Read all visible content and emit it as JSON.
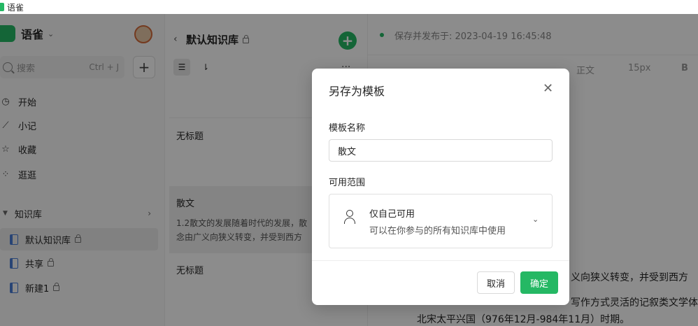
{
  "window": {
    "title": "语雀"
  },
  "sidebar": {
    "brand": "语雀",
    "search": {
      "placeholder": "搜索",
      "shortcut": "Ctrl + J"
    },
    "nav": [
      {
        "label": "开始",
        "icon": "clock-icon"
      },
      {
        "label": "小记",
        "icon": "feather-icon"
      },
      {
        "label": "收藏",
        "icon": "star-icon"
      },
      {
        "label": "逛逛",
        "icon": "grid-icon"
      }
    ],
    "kb_header": "知识库",
    "kb_items": [
      {
        "label": "默认知识库",
        "locked": true,
        "active": true
      },
      {
        "label": "共享",
        "locked": true,
        "active": false
      },
      {
        "label": "新建1",
        "locked": true,
        "active": false
      }
    ]
  },
  "doclist": {
    "title": "默认知识库",
    "docs": [
      {
        "title": "无标题",
        "desc": ""
      },
      {
        "title": "散文",
        "desc_lines": [
          "1.2散文的发展随着时代的发展，散",
          "念由广义向狭义转变，并受到西方"
        ]
      },
      {
        "title": "无标题",
        "desc": ""
      }
    ]
  },
  "editor": {
    "status": "保存并发布于: 2023-04-19 16:45:48",
    "toolbar": {
      "style": "正文",
      "font_size": "15px",
      "bold": "B"
    },
    "body_lines": [
      "义向狭义转变，并受到西方",
      "写作方式灵活的记叙类文学体",
      "北宋太平兴国（976年12月-984年11月）时期。"
    ]
  },
  "modal": {
    "title": "另存为模板",
    "name_label": "模板名称",
    "name_value": "散文",
    "scope_label": "可用范围",
    "scope_option": {
      "title": "仅自己可用",
      "desc": "可以在你参与的所有知识库中使用"
    },
    "cancel": "取消",
    "confirm": "确定"
  },
  "colors": {
    "accent": "#25b864",
    "overlay": "rgba(0,0,0,0.45)"
  }
}
